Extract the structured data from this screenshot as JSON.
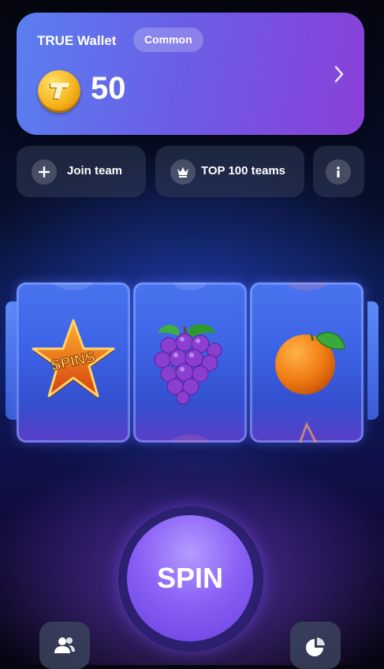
{
  "wallet": {
    "title": "TRUE Wallet",
    "tier": "Common",
    "balance": "50",
    "coin_icon": "true-coin-icon",
    "chevron_icon": "chevron-right-icon"
  },
  "actions": [
    {
      "label": "Join team",
      "icon": "plus-icon"
    },
    {
      "label": "TOP 100 teams",
      "icon": "crown-icon"
    },
    {
      "label": "",
      "icon": "info-icon"
    }
  ],
  "reels": [
    {
      "symbol": "spins-star",
      "text": "SPINS"
    },
    {
      "symbol": "grapes"
    },
    {
      "symbol": "orange"
    }
  ],
  "spin": {
    "label": "SPIN"
  },
  "bottom_nav": [
    {
      "icon": "users-icon"
    },
    {
      "icon": "pie-chart-icon"
    }
  ],
  "colors": {
    "accent": "#8a62f5",
    "card": "#6a5fe6",
    "coin": "#f5b21b"
  }
}
